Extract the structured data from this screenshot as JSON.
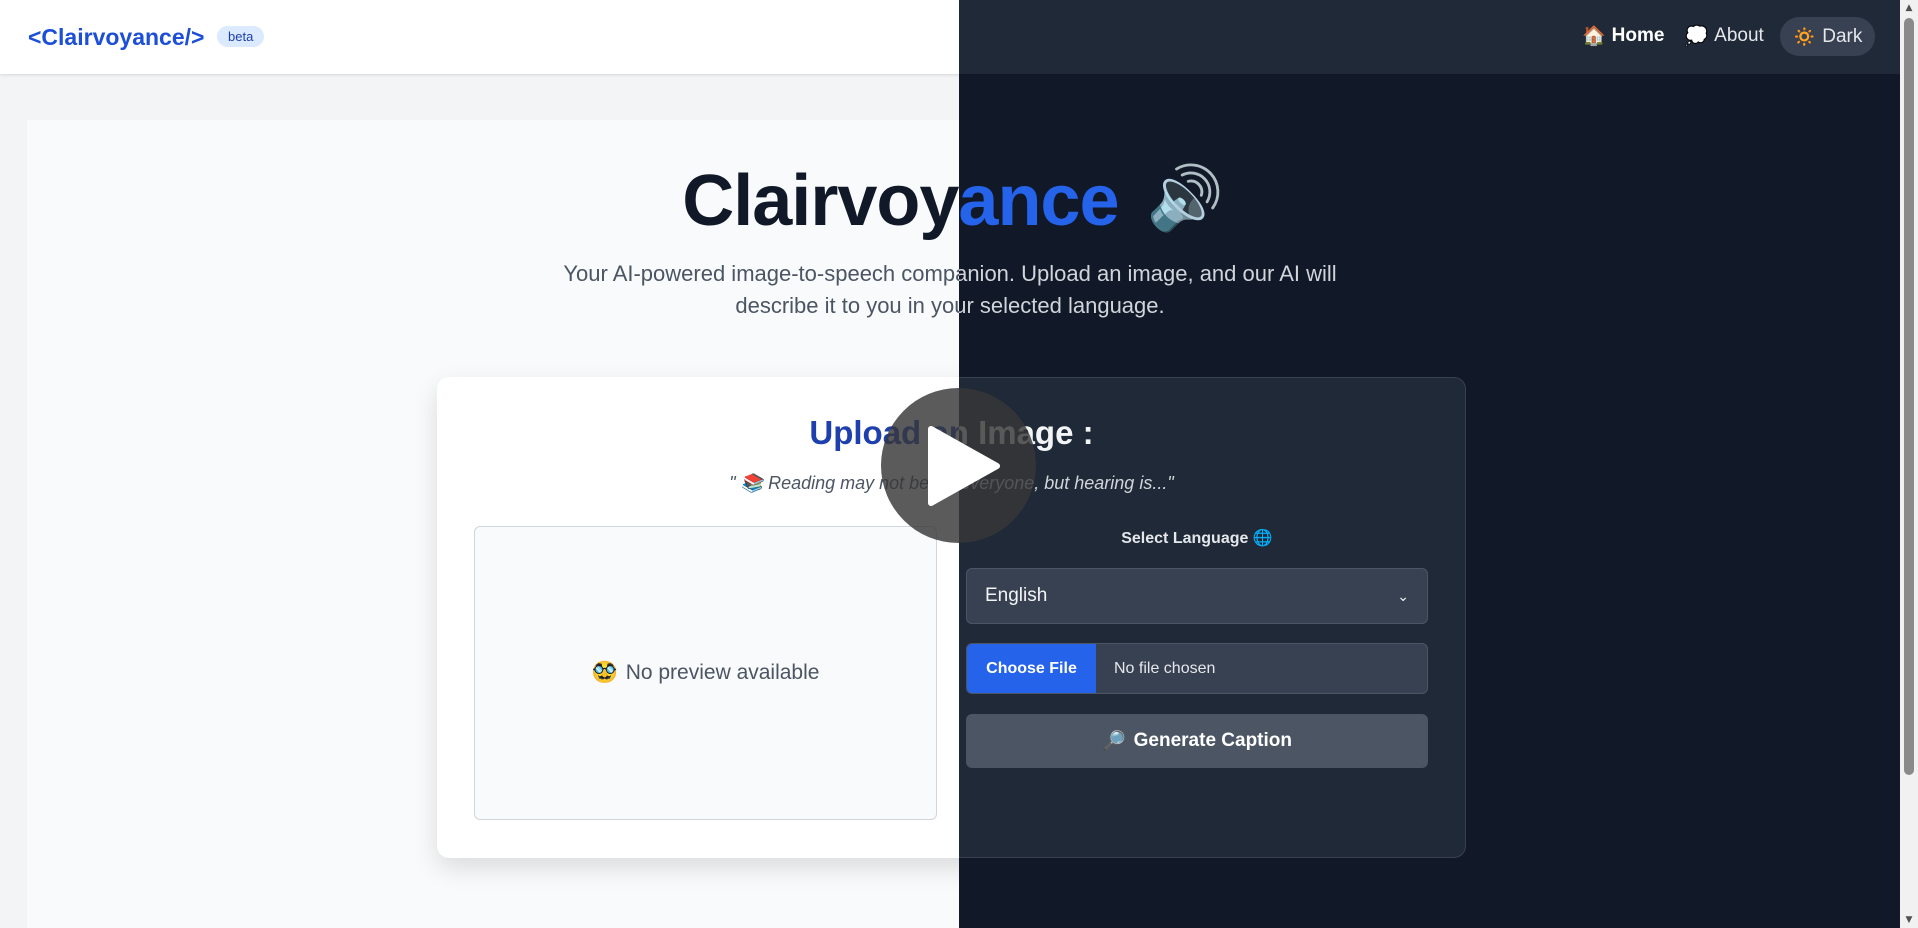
{
  "navbar": {
    "brand": "<Clairvoyance/>",
    "badge": "beta",
    "links": [
      {
        "icon": "🏠",
        "label": "Home"
      },
      {
        "icon": "💭",
        "label": "About"
      }
    ],
    "theme_toggle": {
      "icon": "🔅",
      "label": "Dark"
    }
  },
  "hero": {
    "title": "Clairvoyance",
    "title_icon": "🔊",
    "subtitle": "Your AI-powered image-to-speech companion. Upload an image, and our AI will describe it to you in your selected language."
  },
  "card": {
    "title": "Upload an Image :",
    "quote": "\" 📚 Reading may not be for everyone, but hearing is...\"",
    "preview": {
      "icon": "🥸",
      "text": "No preview available"
    },
    "language_label": "Select Language 🌐",
    "language_value": "English",
    "file_button": "Choose File",
    "file_status": "No file chosen",
    "generate": {
      "icon": "🔎",
      "label": "Generate Caption"
    }
  },
  "colors": {
    "accent": "#2563eb",
    "light_bg": "#f3f4f6",
    "dark_bg": "#111827"
  },
  "icons": [
    "home-icon",
    "thought-bubble-icon",
    "sun-icon",
    "speaker-icon",
    "books-icon",
    "disguise-face-icon",
    "globe-icon",
    "magnifier-icon",
    "play-icon"
  ]
}
